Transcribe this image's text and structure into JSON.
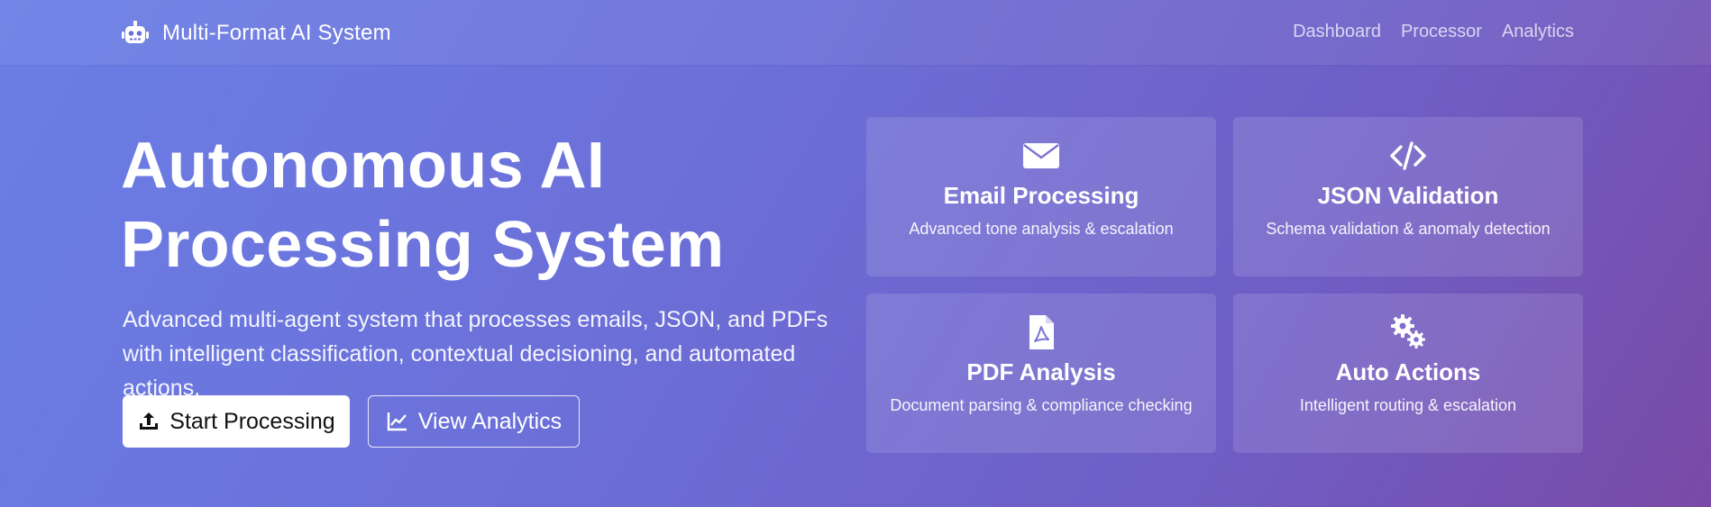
{
  "nav": {
    "brand": "Multi-Format AI System",
    "links": [
      "Dashboard",
      "Processor",
      "Analytics"
    ]
  },
  "hero": {
    "title_line1": "Autonomous AI",
    "title_line2": "Processing System",
    "subtitle": "Advanced multi-agent system that processes emails, JSON, and PDFs with intelligent classification, contextual decisioning, and automated actions.",
    "primary_button": "Start Processing",
    "secondary_button": "View Analytics"
  },
  "features": [
    {
      "icon": "envelope-icon",
      "title": "Email Processing",
      "desc": "Advanced tone analysis & escalation"
    },
    {
      "icon": "code-icon",
      "title": "JSON Validation",
      "desc": "Schema validation & anomaly detection"
    },
    {
      "icon": "pdf-file-icon",
      "title": "PDF Analysis",
      "desc": "Document parsing & compliance checking"
    },
    {
      "icon": "gears-icon",
      "title": "Auto Actions",
      "desc": "Intelligent routing & escalation"
    }
  ],
  "colors": {
    "gradient_start": "#6a7fe6",
    "gradient_end": "#7a4aa6",
    "primary_button_bg": "#ffffff"
  }
}
